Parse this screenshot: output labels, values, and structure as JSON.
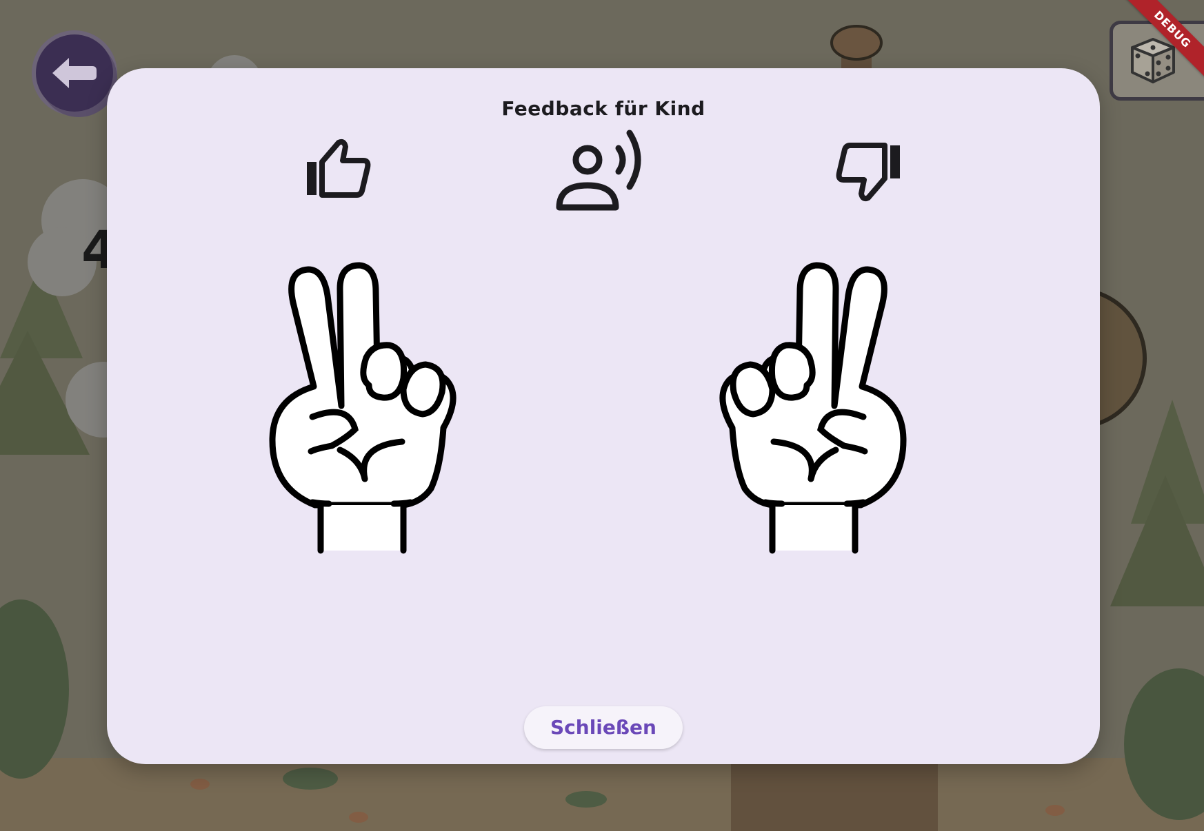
{
  "dialog": {
    "title": "Feedback für Kind",
    "close_label": "Schließen"
  },
  "background": {
    "score_peek": "4"
  },
  "debug_banner": "DEBUG",
  "icons": {
    "thumbs_up": "thumb-up-icon",
    "voice": "record-voice-icon",
    "thumbs_down": "thumb-down-icon",
    "back": "arrow-left-icon",
    "dice": "dice-icon"
  },
  "hands": {
    "left": {
      "fingers_shown": 2
    },
    "right": {
      "fingers_shown": 2
    }
  },
  "colors": {
    "dialog_bg": "#ece6f5",
    "accent": "#6a48b8",
    "icon": "#1c1b1f",
    "debug": "#b0232a"
  }
}
